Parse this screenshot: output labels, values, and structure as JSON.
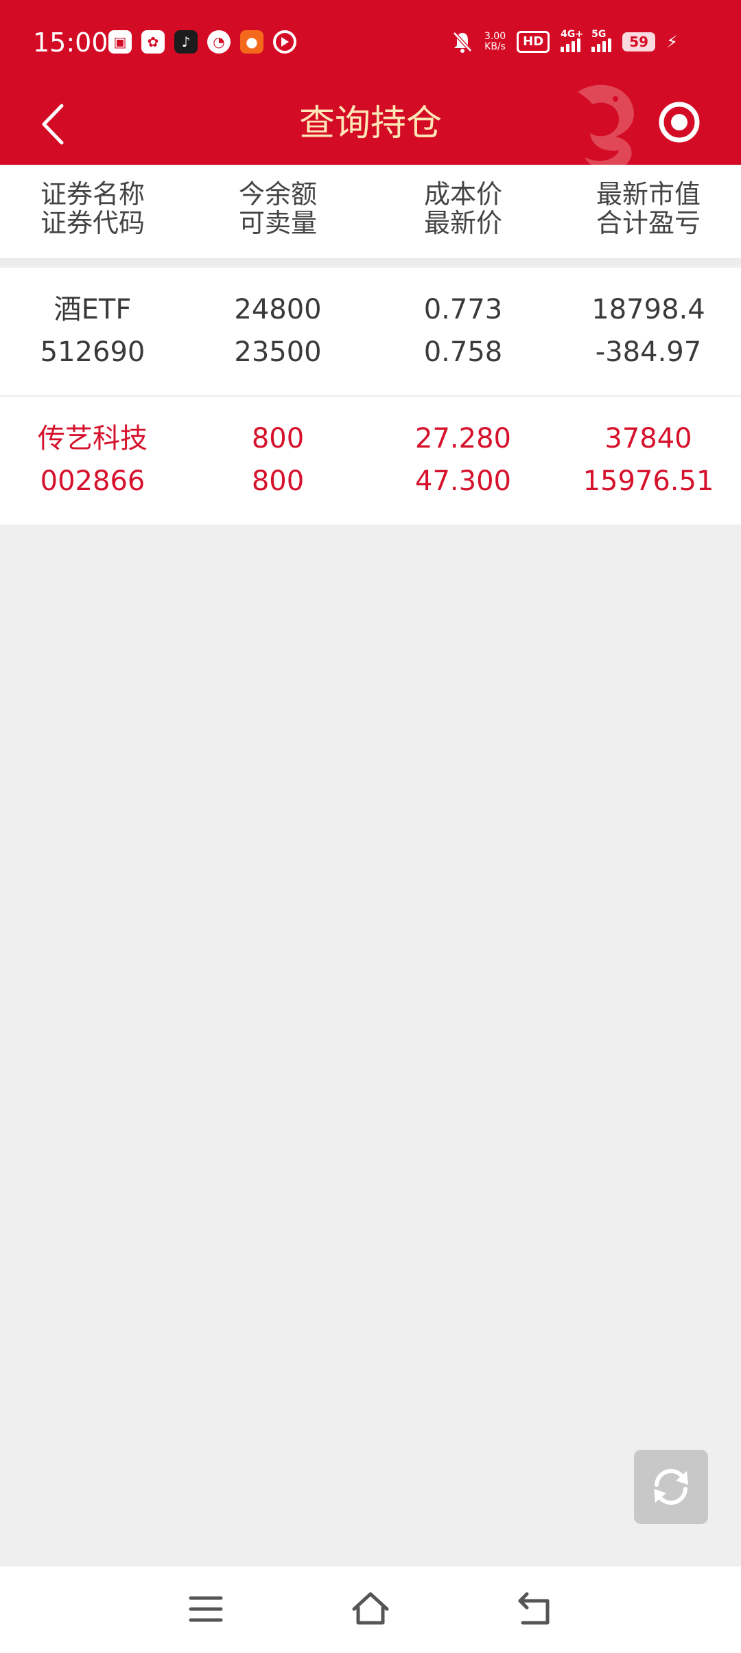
{
  "status_bar": {
    "time": "15:00",
    "net_speed_value": "3.00",
    "net_speed_unit": "KB/s",
    "hd_label": "HD",
    "sig1_label": "4G+",
    "sig2_label": "5G",
    "battery": "59",
    "app_icons": [
      "photo-app-icon",
      "video-app-icon",
      "tiktok-icon",
      "speedometer-app-icon",
      "orange-app-icon",
      "play-app-icon"
    ]
  },
  "header": {
    "title": "查询持仓"
  },
  "table": {
    "columns": [
      {
        "line1": "证券名称",
        "line2": "证券代码"
      },
      {
        "line1": "今余额",
        "line2": "可卖量"
      },
      {
        "line1": "成本价",
        "line2": "最新价"
      },
      {
        "line1": "最新市值",
        "line2": "合计盈亏"
      }
    ],
    "rows": [
      {
        "name": "酒ETF",
        "code": "512690",
        "balance": "24800",
        "sellable": "23500",
        "cost_price": "0.773",
        "latest_price": "0.758",
        "market_value": "18798.4",
        "profit_loss": "-384.97",
        "color": "#3a3a3a"
      },
      {
        "name": "传艺科技",
        "code": "002866",
        "balance": "800",
        "sellable": "800",
        "cost_price": "27.280",
        "latest_price": "47.300",
        "market_value": "37840",
        "profit_loss": "15976.51",
        "color": "#d6112b"
      }
    ]
  },
  "colors": {
    "brand_red": "#d40b24",
    "title_gold": "#fde6b8",
    "profit_red": "#d6112b"
  }
}
